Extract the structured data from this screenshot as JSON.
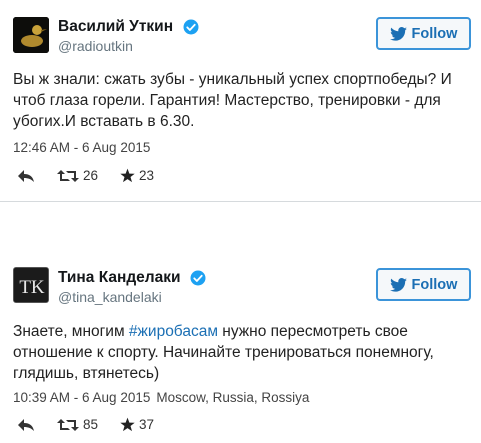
{
  "tweets": [
    {
      "author_name": "Василий Уткин",
      "handle": "@radioutkin",
      "follow_label": "Follow",
      "text": "Вы ж знали: сжать зубы - уникальный успех спортпобеды? И чтоб глаза горели. Гарантия! Мастерство, тренировки - для убогих.И вставать в 6.30.",
      "timestamp": "12:46 AM - 6 Aug 2015",
      "location": "",
      "retweets": "26",
      "likes": "23"
    },
    {
      "author_name": "Тина Канделаки",
      "handle": "@tina_kandelaki",
      "follow_label": "Follow",
      "text_before": "Знаете, многим ",
      "hashtag": "#жиробасам",
      "text_after": " нужно пересмотреть свое отношение к спорту. Начинайте тренироваться понемногу, глядишь, втянетесь)",
      "timestamp": "10:39 AM - 6 Aug 2015",
      "location": "Moscow, Russia, Rossiya",
      "retweets": "85",
      "likes": "37",
      "avatar_monogram": "TK"
    }
  ],
  "colors": {
    "accent": "#1b6fb4",
    "verified": "#1da1f2",
    "follow_border": "#3b94d9"
  },
  "icons": [
    "verified-badge-icon",
    "twitter-bird-icon",
    "reply-icon",
    "retweet-icon",
    "star-icon"
  ]
}
